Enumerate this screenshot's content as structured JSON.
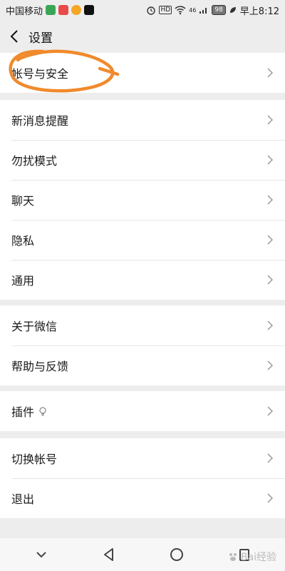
{
  "statusbar": {
    "carrier": "中国移动",
    "battery": "98",
    "time": "早上8:12",
    "hd": "HD",
    "signal_label": "46"
  },
  "nav": {
    "title": "设置"
  },
  "groups": [
    {
      "items": [
        {
          "label": "帐号与安全"
        }
      ]
    },
    {
      "items": [
        {
          "label": "新消息提醒"
        },
        {
          "label": "勿扰模式"
        },
        {
          "label": "聊天"
        },
        {
          "label": "隐私"
        },
        {
          "label": "通用"
        }
      ]
    },
    {
      "items": [
        {
          "label": "关于微信"
        },
        {
          "label": "帮助与反馈"
        }
      ]
    },
    {
      "items": [
        {
          "label": "插件"
        }
      ]
    },
    {
      "items": [
        {
          "label": "切换帐号"
        },
        {
          "label": "退出"
        }
      ]
    }
  ],
  "watermark": "Bai经验",
  "colors": {
    "annotation": "#f08a2c",
    "background": "#ededed",
    "row_bg": "#ffffff"
  }
}
